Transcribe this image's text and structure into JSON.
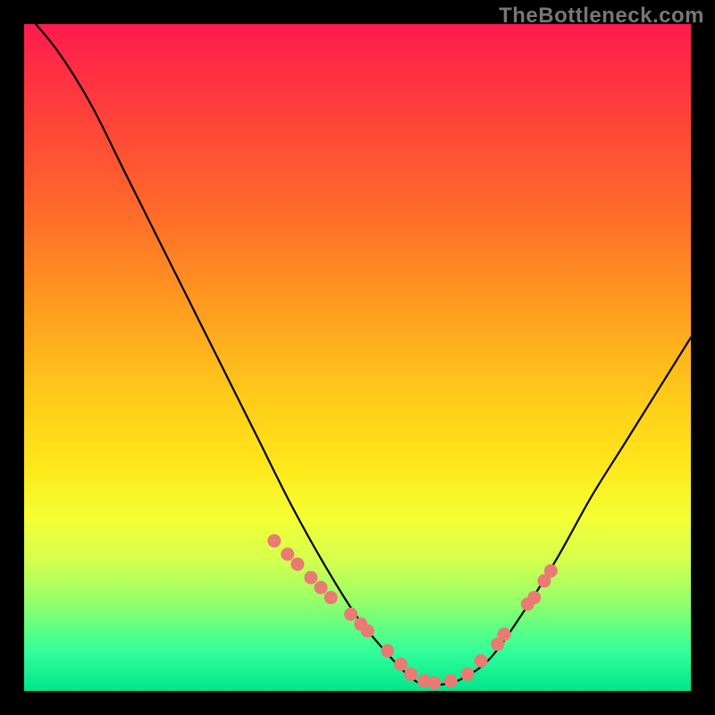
{
  "watermark": "TheBottleneck.com",
  "colors": {
    "frame": "#000000",
    "curve": "#000000",
    "dots": "#e97b73",
    "gradient_top": "#ff1a4d",
    "gradient_bottom": "#00e68a"
  },
  "chart_data": {
    "type": "line",
    "title": "",
    "xlabel": "",
    "ylabel": "",
    "xlim": [
      0,
      1
    ],
    "ylim": [
      0,
      1
    ],
    "annotations": [
      "TheBottleneck.com"
    ],
    "series": [
      {
        "name": "bottleneck-curve",
        "x": [
          0.0,
          0.05,
          0.1,
          0.15,
          0.2,
          0.25,
          0.3,
          0.35,
          0.4,
          0.45,
          0.5,
          0.55,
          0.58,
          0.6,
          0.63,
          0.66,
          0.7,
          0.75,
          0.8,
          0.85,
          0.9,
          0.95,
          1.0
        ],
        "y": [
          1.02,
          0.96,
          0.88,
          0.78,
          0.68,
          0.58,
          0.48,
          0.38,
          0.28,
          0.19,
          0.11,
          0.05,
          0.02,
          0.01,
          0.01,
          0.02,
          0.05,
          0.12,
          0.2,
          0.29,
          0.37,
          0.45,
          0.53
        ]
      }
    ],
    "highlight_points": {
      "name": "highlight-dots",
      "x": [
        0.375,
        0.395,
        0.41,
        0.43,
        0.445,
        0.46,
        0.49,
        0.505,
        0.515,
        0.545,
        0.565,
        0.58,
        0.6,
        0.615,
        0.64,
        0.665,
        0.685,
        0.71,
        0.72,
        0.755,
        0.765,
        0.78,
        0.79
      ],
      "y": [
        0.225,
        0.205,
        0.19,
        0.17,
        0.155,
        0.14,
        0.115,
        0.1,
        0.09,
        0.06,
        0.04,
        0.025,
        0.015,
        0.012,
        0.015,
        0.025,
        0.045,
        0.07,
        0.085,
        0.13,
        0.14,
        0.165,
        0.18
      ]
    }
  }
}
